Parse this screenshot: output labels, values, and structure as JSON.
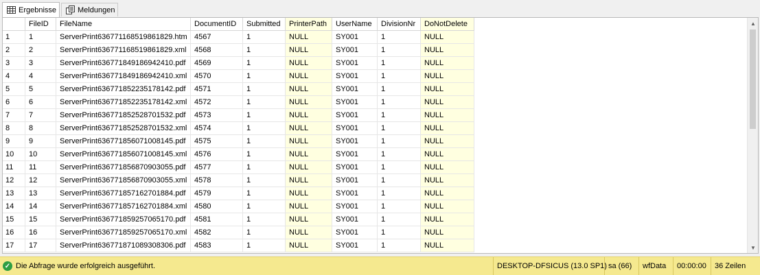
{
  "tabs": [
    {
      "label": "Ergebnisse",
      "icon": "grid-icon",
      "active": true
    },
    {
      "label": "Meldungen",
      "icon": "messages-icon",
      "active": false
    }
  ],
  "columns": [
    "",
    "FileID",
    "FileName",
    "DocumentID",
    "Submitted",
    "PrinterPath",
    "UserName",
    "DivisionNr",
    "DoNotDelete"
  ],
  "rows": [
    [
      "1",
      "1",
      "ServerPrint636771168519861829.htm",
      "4567",
      "1",
      "NULL",
      "SY001",
      "1",
      "NULL"
    ],
    [
      "2",
      "2",
      "ServerPrint636771168519861829.xml",
      "4568",
      "1",
      "NULL",
      "SY001",
      "1",
      "NULL"
    ],
    [
      "3",
      "3",
      "ServerPrint636771849186942410.pdf",
      "4569",
      "1",
      "NULL",
      "SY001",
      "1",
      "NULL"
    ],
    [
      "4",
      "4",
      "ServerPrint636771849186942410.xml",
      "4570",
      "1",
      "NULL",
      "SY001",
      "1",
      "NULL"
    ],
    [
      "5",
      "5",
      "ServerPrint636771852235178142.pdf",
      "4571",
      "1",
      "NULL",
      "SY001",
      "1",
      "NULL"
    ],
    [
      "6",
      "6",
      "ServerPrint636771852235178142.xml",
      "4572",
      "1",
      "NULL",
      "SY001",
      "1",
      "NULL"
    ],
    [
      "7",
      "7",
      "ServerPrint636771852528701532.pdf",
      "4573",
      "1",
      "NULL",
      "SY001",
      "1",
      "NULL"
    ],
    [
      "8",
      "8",
      "ServerPrint636771852528701532.xml",
      "4574",
      "1",
      "NULL",
      "SY001",
      "1",
      "NULL"
    ],
    [
      "9",
      "9",
      "ServerPrint636771856071008145.pdf",
      "4575",
      "1",
      "NULL",
      "SY001",
      "1",
      "NULL"
    ],
    [
      "10",
      "10",
      "ServerPrint636771856071008145.xml",
      "4576",
      "1",
      "NULL",
      "SY001",
      "1",
      "NULL"
    ],
    [
      "11",
      "11",
      "ServerPrint636771856870903055.pdf",
      "4577",
      "1",
      "NULL",
      "SY001",
      "1",
      "NULL"
    ],
    [
      "12",
      "12",
      "ServerPrint636771856870903055.xml",
      "4578",
      "1",
      "NULL",
      "SY001",
      "1",
      "NULL"
    ],
    [
      "13",
      "13",
      "ServerPrint636771857162701884.pdf",
      "4579",
      "1",
      "NULL",
      "SY001",
      "1",
      "NULL"
    ],
    [
      "14",
      "14",
      "ServerPrint636771857162701884.xml",
      "4580",
      "1",
      "NULL",
      "SY001",
      "1",
      "NULL"
    ],
    [
      "15",
      "15",
      "ServerPrint636771859257065170.pdf",
      "4581",
      "1",
      "NULL",
      "SY001",
      "1",
      "NULL"
    ],
    [
      "16",
      "16",
      "ServerPrint636771859257065170.xml",
      "4582",
      "1",
      "NULL",
      "SY001",
      "1",
      "NULL"
    ],
    [
      "17",
      "17",
      "ServerPrint636771871089308306.pdf",
      "4583",
      "1",
      "NULL",
      "SY001",
      "1",
      "NULL"
    ]
  ],
  "scrollbar": {
    "position_fraction": 0.0,
    "visible_fraction": 0.47
  },
  "status": {
    "message": "Die Abfrage wurde erfolgreich ausgeführt.",
    "server": "DESKTOP-DFSICUS (13.0 SP1)",
    "user": "sa (66)",
    "database": "wfData",
    "elapsed": "00:00:00",
    "rows": "36 Zeilen"
  },
  "colors": {
    "status_bg": "#f5e98f",
    "null_bg": "#ffffe0",
    "ok_icon": "#2e9e43"
  }
}
